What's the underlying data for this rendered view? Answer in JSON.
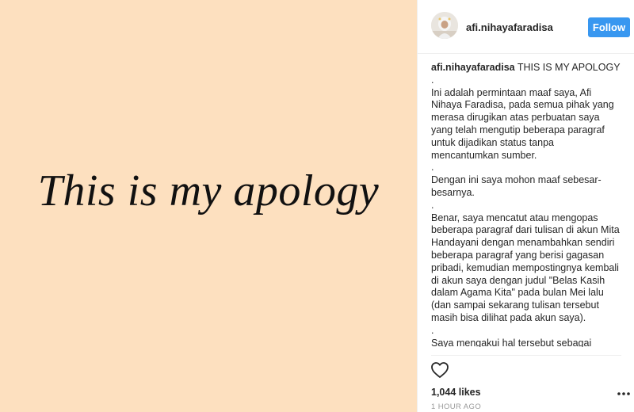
{
  "post": {
    "image_text": "This is my apology",
    "image_background": "#fde0bf"
  },
  "header": {
    "username": "afi.nihayafaradisa",
    "follow_label": "Follow",
    "follow_color": "#3897f0"
  },
  "caption": {
    "username": "afi.nihayafaradisa",
    "body": " THIS IS MY APOLOGY\n.\nIni adalah permintaan maaf saya, Afi Nihaya Faradisa, pada semua pihak yang merasa dirugikan atas perbuatan saya yang telah mengutip beberapa paragraf untuk dijadikan status tanpa mencantumkan sumber.\n.\nDengan ini saya mohon maaf sebesar-besarnya.\n.\nBenar, saya mencatut atau mengopas beberapa paragraf dari tulisan di akun Mita Handayani dengan menambahkan sendiri beberapa paragraf yang berisi gagasan pribadi, kemudian mempostingnya kembali di akun saya dengan judul \"Belas Kasih dalam Agama Kita\" pada bulan Mei lalu (dan sampai sekarang tulisan tersebut masih bisa dilihat pada akun saya).\n.\nSaya mengakui hal tersebut sebagai sebuah kesalahan. Saya juga tidak akan membela"
  },
  "footer": {
    "likes": "1,044 likes",
    "timestamp": "1 HOUR AGO",
    "like_icon": "heart-outline-icon",
    "more_icon": "more-options-icon"
  }
}
